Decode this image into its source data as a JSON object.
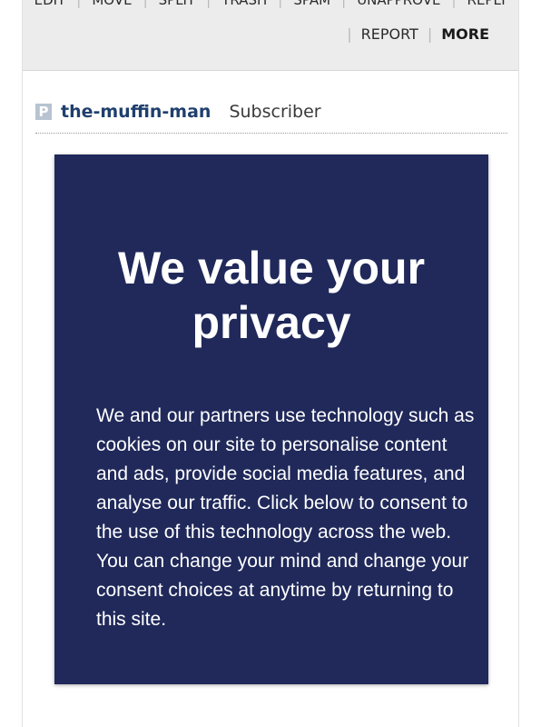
{
  "toolbar": {
    "row1": [
      "EDIT",
      "MOVE",
      "SPLIT",
      "TRASH",
      "SPAM",
      "UNAPPROVE",
      "REPLY"
    ],
    "report": "REPORT",
    "more": "MORE"
  },
  "author": {
    "badge": "P",
    "username": "the-muffin-man",
    "role": "Subscriber"
  },
  "consent": {
    "title": "We value your privacy",
    "body": "We and our partners use technology such as cookies on our site to personalise content and ads, provide social media features, and analyse our traffic. Click below to consent to the use of this technology across the web. You can change your mind and change your consent choices at anytime by returning to this site."
  },
  "colors": {
    "modal_bg": "#20295a",
    "username": "#1f3f6e",
    "toolbar_bg": "#ececec"
  }
}
